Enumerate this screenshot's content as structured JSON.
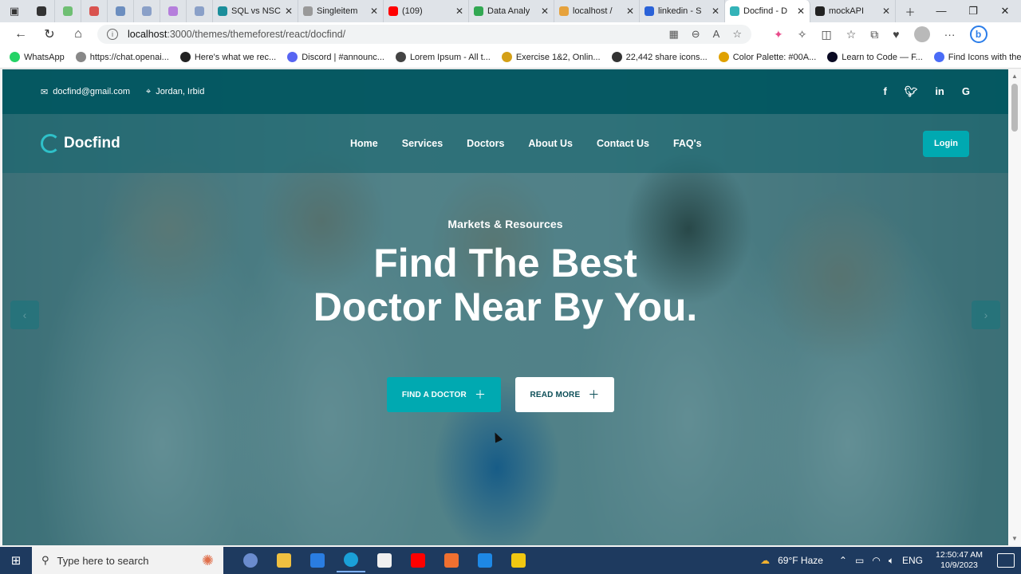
{
  "browser": {
    "tabs": [
      {
        "label": "",
        "color": "#333333",
        "size": "small"
      },
      {
        "label": "",
        "color": "#6fbf73",
        "size": "small"
      },
      {
        "label": "",
        "color": "#d9534f",
        "size": "small"
      },
      {
        "label": "",
        "color": "#6c8ebf",
        "size": "small"
      },
      {
        "label": "",
        "color": "#8aa0c8",
        "size": "small"
      },
      {
        "label": "",
        "color": "#b57edc",
        "size": "small"
      },
      {
        "label": "",
        "color": "#8aa0c8",
        "size": "small"
      },
      {
        "label": "SQL vs NSC",
        "color": "#1b8e9b",
        "size": "wide"
      },
      {
        "label": "Singleitem",
        "color": "#999999",
        "size": "wide"
      },
      {
        "label": "(109)",
        "color": "#ff0000",
        "size": "wide"
      },
      {
        "label": "Data Analy",
        "color": "#32a852",
        "size": "wide"
      },
      {
        "label": "localhost /",
        "color": "#e6a23c",
        "size": "wide"
      },
      {
        "label": "linkedin - S",
        "color": "#2a62d8",
        "size": "wide"
      },
      {
        "label": "Docfind - D",
        "color": "#34b3b8",
        "size": "wide",
        "active": true
      },
      {
        "label": "mockAPI",
        "color": "#222222",
        "size": "wide"
      }
    ],
    "url_host": "localhost",
    "url_path": ":3000/themes/themeforest/react/docfind/",
    "bookmarks": [
      {
        "label": "WhatsApp",
        "color": "#25d366"
      },
      {
        "label": "https://chat.openai...",
        "color": "#888888"
      },
      {
        "label": "Here's what we rec...",
        "color": "#222222"
      },
      {
        "label": "Discord | #announc...",
        "color": "#5865f2"
      },
      {
        "label": "Lorem Ipsum - All t...",
        "color": "#444444"
      },
      {
        "label": "Exercise 1&2, Onlin...",
        "color": "#d4a017"
      },
      {
        "label": "22,442 share icons...",
        "color": "#333333"
      },
      {
        "label": "Color Palette: #00A...",
        "color": "#e0a100"
      },
      {
        "label": "Learn to Code — F...",
        "color": "#0a0a23"
      },
      {
        "label": "Find Icons with the...",
        "color": "#4a6cf7"
      }
    ]
  },
  "site": {
    "email": "docfind@gmail.com",
    "location": "Jordan, Irbid",
    "socials": [
      "f",
      "t",
      "in",
      "G"
    ],
    "logo": "Docfind",
    "nav": [
      "Home",
      "Services",
      "Doctors",
      "About Us",
      "Contact Us",
      "FAQ's"
    ],
    "login_label": "Login",
    "kicker": "Markets & Resources",
    "headline_line1": "Find The Best",
    "headline_line2": "Doctor Near By You.",
    "btn_primary": "FIND A DOCTOR",
    "btn_secondary": "READ MORE",
    "colors": {
      "accent": "#00a9b1",
      "topbar": "#005660"
    }
  },
  "taskbar": {
    "search_placeholder": "Type here to search",
    "weather": "69°F  Haze",
    "lang": "ENG",
    "time": "12:50:47 AM",
    "date": "10/9/2023"
  }
}
